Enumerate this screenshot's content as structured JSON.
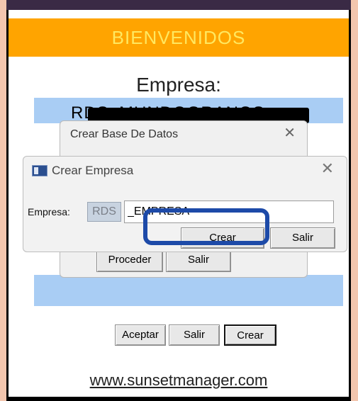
{
  "banner": {
    "title": "BIENVENIDOS"
  },
  "company": {
    "label": "Empresa:",
    "name_visible": "RDS_MUNDOGRANOS"
  },
  "back_dialog": {
    "title": "Crear Base De Datos",
    "proceed_label": "Proceder",
    "exit_label": "Salir"
  },
  "front_dialog": {
    "title": "Crear Empresa",
    "field_label": "Empresa:",
    "prefix": "RDS",
    "field_value": "_EMPRESA",
    "create_label": "Crear",
    "exit_label": "Salir"
  },
  "bottom_buttons": {
    "accept_label": "Aceptar",
    "exit_label": "Salir",
    "create_label": "Crear"
  },
  "footer": {
    "website": "www.sunsetmanager.com"
  },
  "colors": {
    "banner": "#ffa400",
    "banner_text": "#ffe860",
    "band": "#a9cdf4",
    "highlight": "#1d4aa8"
  }
}
